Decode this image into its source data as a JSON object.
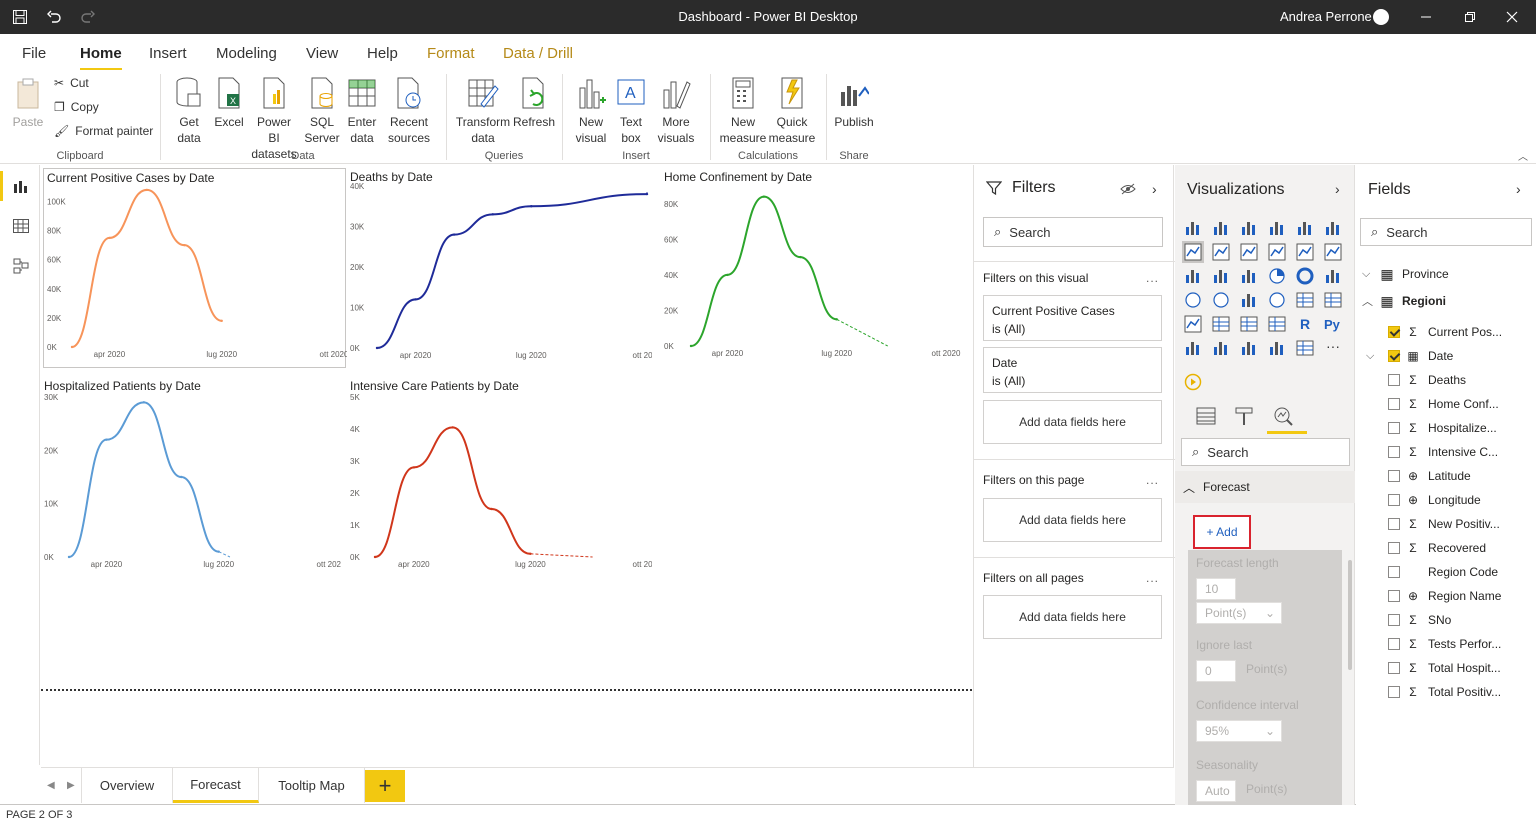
{
  "titlebar": {
    "title": "Dashboard - Power BI Desktop",
    "user": "Andrea Perrone"
  },
  "menu": {
    "file": "File",
    "home": "Home",
    "insert": "Insert",
    "modeling": "Modeling",
    "view": "View",
    "help": "Help",
    "format": "Format",
    "datadrill": "Data / Drill"
  },
  "ribbon": {
    "paste": "Paste",
    "cut": "Cut",
    "copy": "Copy",
    "format_painter": "Format painter",
    "clipboard": "Clipboard",
    "get_data": "Get data",
    "excel": "Excel",
    "powerbi_datasets": "Power BI datasets",
    "sql_server": "SQL Server",
    "enter_data": "Enter data",
    "recent_sources": "Recent sources",
    "data": "Data",
    "transform_data": "Transform data",
    "refresh": "Refresh",
    "queries": "Queries",
    "new_visual": "New visual",
    "text_box": "Text box",
    "more_visuals": "More visuals",
    "insert": "Insert",
    "new_measure": "New measure",
    "quick_measure": "Quick measure",
    "calculations": "Calculations",
    "publish": "Publish",
    "share": "Share"
  },
  "charts": [
    {
      "title": "Current Positive Cases by Date",
      "yticks": [
        "100K",
        "80K",
        "60K",
        "40K",
        "20K",
        "0K"
      ],
      "xticks": [
        "apr 2020",
        "lug 2020",
        "ott 2020"
      ],
      "color": "#f7945a"
    },
    {
      "title": "Deaths by Date",
      "yticks": [
        "40K",
        "30K",
        "20K",
        "10K",
        "0K"
      ],
      "xticks": [
        "apr 2020",
        "lug 2020",
        "ott 2020"
      ],
      "color": "#1f2b99"
    },
    {
      "title": "Home Confinement by Date",
      "yticks": [
        "80K",
        "60K",
        "40K",
        "20K",
        "0K"
      ],
      "xticks": [
        "apr 2020",
        "lug 2020",
        "ott 2020"
      ],
      "color": "#2ca52c"
    },
    {
      "title": "Hospitalized Patients by Date",
      "yticks": [
        "30K",
        "20K",
        "10K",
        "0K"
      ],
      "xticks": [
        "apr 2020",
        "lug 2020",
        "ott 2020"
      ],
      "color": "#5b9bd5"
    },
    {
      "title": "Intensive Care Patients by Date",
      "yticks": [
        "5K",
        "4K",
        "3K",
        "2K",
        "1K",
        "0K"
      ],
      "xticks": [
        "apr 2020",
        "lug 2020",
        "ott 2020"
      ],
      "color": "#d0361b"
    }
  ],
  "chart_data": [
    {
      "type": "line",
      "title": "Current Positive Cases by Date",
      "x": [
        "mar 2020",
        "apr 2020",
        "mag 2020",
        "giu 2020",
        "lug 2020"
      ],
      "series": [
        {
          "values": [
            0,
            75000,
            108000,
            70000,
            18000
          ]
        }
      ],
      "ylim": [
        0,
        110000
      ]
    },
    {
      "type": "line",
      "title": "Deaths by Date",
      "x": [
        "mar 2020",
        "apr 2020",
        "mag 2020",
        "giu 2020",
        "lug 2020",
        "ott 2020"
      ],
      "series": [
        {
          "values": [
            0,
            12000,
            28000,
            33000,
            35000,
            38000
          ]
        }
      ],
      "ylim": [
        0,
        40000
      ]
    },
    {
      "type": "line",
      "title": "Home Confinement by Date",
      "x": [
        "mar 2020",
        "apr 2020",
        "mag 2020",
        "giu 2020",
        "lug 2020"
      ],
      "series": [
        {
          "values": [
            0,
            40000,
            84000,
            50000,
            15000
          ]
        }
      ],
      "ylim": [
        0,
        90000
      ]
    },
    {
      "type": "line",
      "title": "Hospitalized Patients by Date",
      "x": [
        "mar 2020",
        "apr 2020",
        "mag 2020",
        "giu 2020",
        "lug 2020"
      ],
      "series": [
        {
          "values": [
            0,
            22000,
            29000,
            15000,
            1000
          ]
        }
      ],
      "ylim": [
        0,
        30000
      ]
    },
    {
      "type": "line",
      "title": "Intensive Care Patients by Date",
      "x": [
        "mar 2020",
        "apr 2020",
        "mag 2020",
        "giu 2020",
        "lug 2020"
      ],
      "series": [
        {
          "values": [
            0,
            2800,
            4050,
            1500,
            100
          ]
        }
      ],
      "ylim": [
        0,
        5000
      ]
    }
  ],
  "pages": {
    "overview": "Overview",
    "forecast": "Forecast",
    "tooltip_map": "Tooltip Map",
    "add": "+"
  },
  "status": "PAGE 2 OF 3",
  "filters": {
    "title": "Filters",
    "search": "Search",
    "on_visual": "Filters on this visual",
    "on_page": "Filters on this page",
    "on_all": "Filters on all pages",
    "card1_name": "Current Positive Cases",
    "card1_val": "is (All)",
    "card2_name": "Date",
    "card2_val": "is (All)",
    "add_fields": "Add data fields here",
    "dots": "..."
  },
  "viz": {
    "title": "Visualizations",
    "search": "Search",
    "forecast": "Forecast",
    "add": "+ Add",
    "forecast_length": "Forecast length",
    "forecast_length_val": "10",
    "points": "Point(s)",
    "ignore_last": "Ignore last",
    "ignore_last_val": "0",
    "confidence": "Confidence interval",
    "confidence_val": "95%",
    "seasonality": "Seasonality",
    "seasonality_val": "Auto"
  },
  "fields": {
    "title": "Fields",
    "search": "Search",
    "items": [
      {
        "label": "Province"
      },
      {
        "label": "Regioni"
      },
      {
        "label": "Current Pos..."
      },
      {
        "label": "Date"
      },
      {
        "label": "Deaths"
      },
      {
        "label": "Home Conf..."
      },
      {
        "label": "Hospitalize..."
      },
      {
        "label": "Intensive C..."
      },
      {
        "label": "Latitude"
      },
      {
        "label": "Longitude"
      },
      {
        "label": "New Positiv..."
      },
      {
        "label": "Recovered"
      },
      {
        "label": "Region Code"
      },
      {
        "label": "Region Name"
      },
      {
        "label": "SNo"
      },
      {
        "label": "Tests Perfor..."
      },
      {
        "label": "Total Hospit..."
      },
      {
        "label": "Total Positiv..."
      }
    ]
  }
}
